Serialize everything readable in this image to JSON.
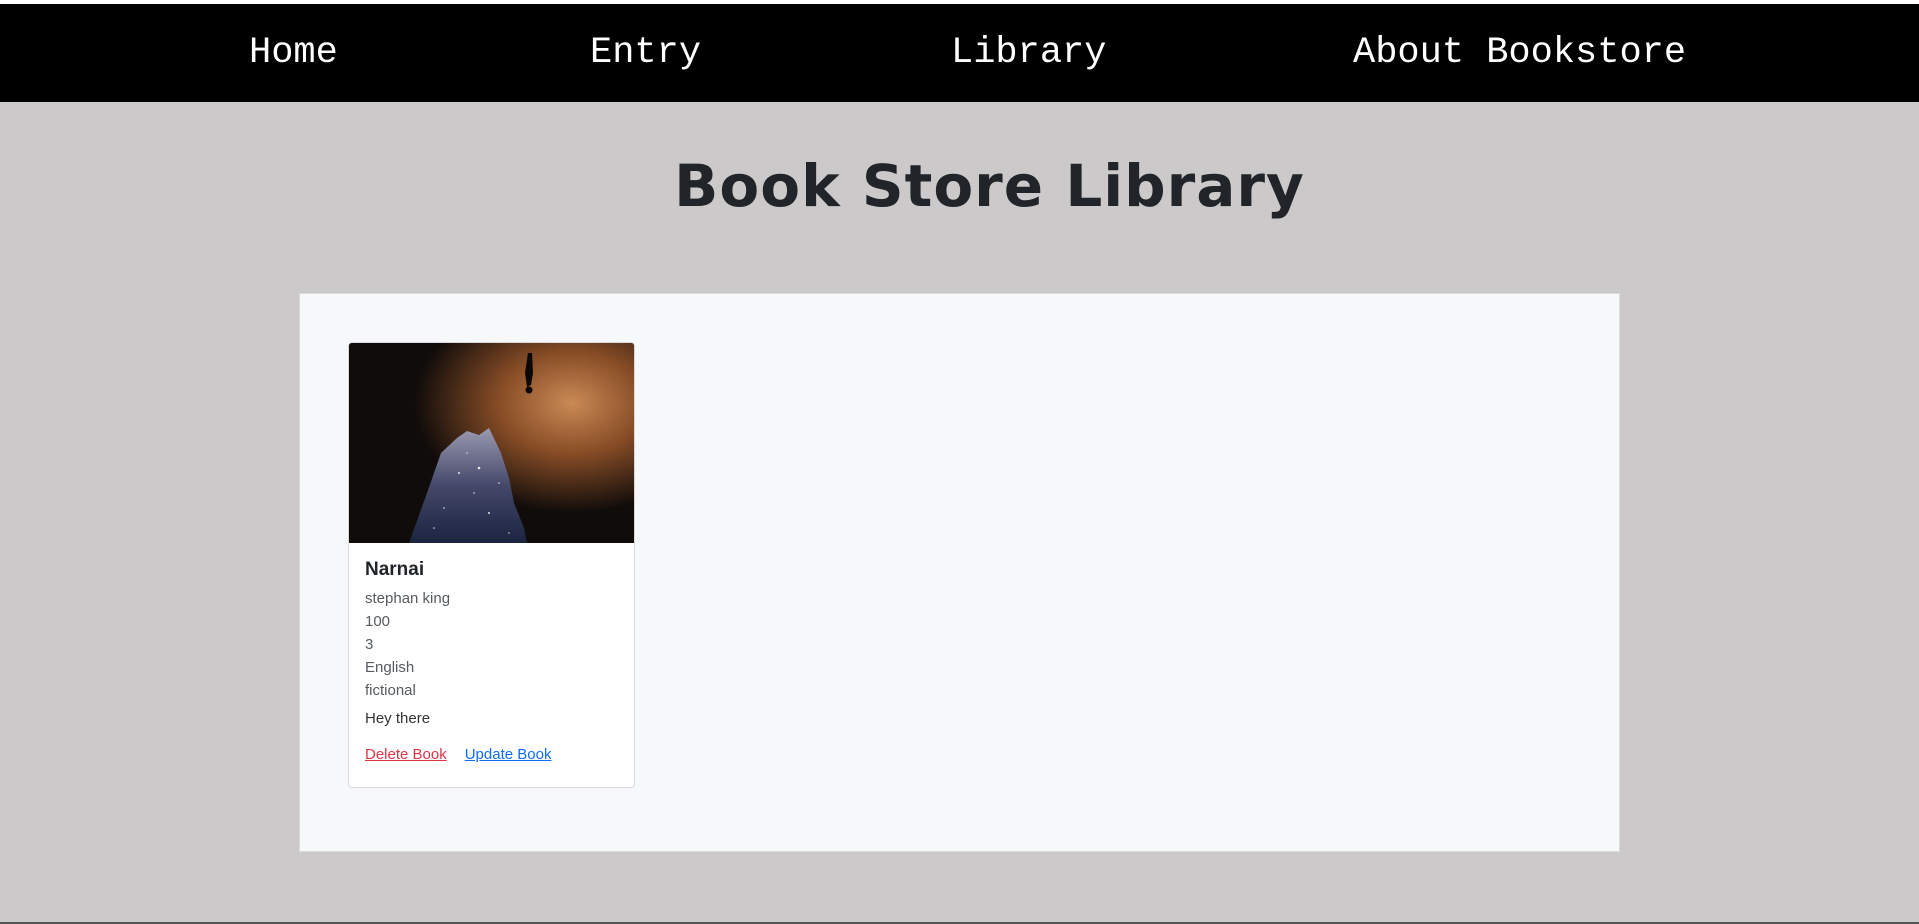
{
  "nav": {
    "items": [
      {
        "label": "Home"
      },
      {
        "label": "Entry"
      },
      {
        "label": "Library"
      },
      {
        "label": "About Bookstore"
      }
    ]
  },
  "page": {
    "title": "Book Store Library"
  },
  "book": {
    "title": "Narnai",
    "author": "stephan king",
    "price": "100",
    "quantity": "3",
    "language": "English",
    "genre": "fictional",
    "description": "Hey there",
    "delete_label": "Delete Book",
    "update_label": "Update Book"
  },
  "colors": {
    "navbar": "#000000",
    "background": "#cbc9ca",
    "panel": "#f7f8fa",
    "delete_link": "#dc3545",
    "update_link": "#0d6efd"
  },
  "icons": {
    "cover": "book-cover-image"
  }
}
